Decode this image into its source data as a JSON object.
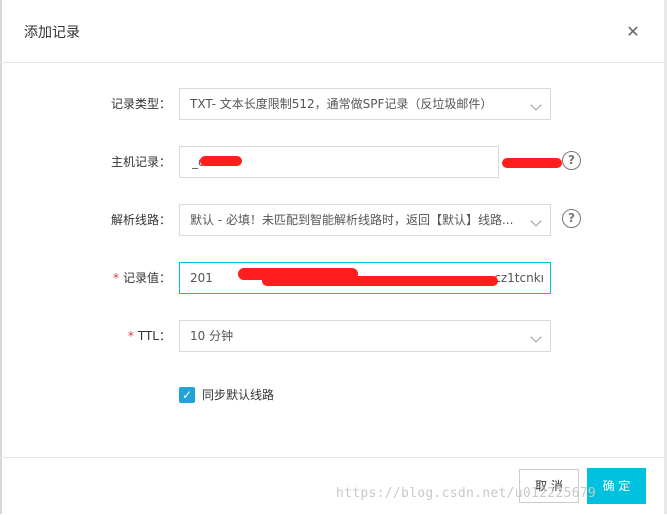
{
  "dialog": {
    "title": "添加记录",
    "close_icon": "close-icon"
  },
  "form": {
    "record_type": {
      "label": "记录类型：",
      "value": "TXT- 文本长度限制512，通常做SPF记录（反垃圾邮件）"
    },
    "host": {
      "label": "主机记录：",
      "value": "_d"
    },
    "line": {
      "label": "解析线路：",
      "value": "默认 - 必填！未匹配到智能解析线路时，返回【默认】线路..."
    },
    "record_value": {
      "required_mark": "*",
      "label": "记录值：",
      "value_start": "201",
      "value_end": "cz1tcnkı"
    },
    "ttl": {
      "required_mark": "*",
      "label": "TTL：",
      "value": "10 分钟"
    },
    "sync": {
      "label": "同步默认线路",
      "checked": true
    }
  },
  "footer": {
    "cancel_label": "取 消",
    "ok_label": "确 定"
  },
  "watermark": "https://blog.csdn.net/u012225679",
  "colors": {
    "accent": "#00c1de",
    "checkbox": "#1fa3d9",
    "required": "#e4393c",
    "redaction": "#ff1e1e"
  }
}
